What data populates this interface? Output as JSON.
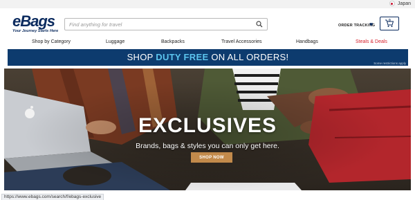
{
  "locale": {
    "label": "Japan"
  },
  "header": {
    "logo_text": "eBags",
    "logo_tagline": "Your Journey Starts Here",
    "search_placeholder": "Find anything for travel",
    "order_tracking": "ORDER TRACKING",
    "cart_count": "0"
  },
  "nav": {
    "items": [
      {
        "label": "Shop by Category"
      },
      {
        "label": "Luggage"
      },
      {
        "label": "Backpacks"
      },
      {
        "label": "Travel Accessories"
      },
      {
        "label": "Handbags"
      },
      {
        "label": "Steals & Deals"
      }
    ]
  },
  "banner": {
    "text_pre": "SHOP ",
    "text_highlight": "DUTY FREE",
    "text_post": " ON ALL ORDERS!",
    "note": "Some restrictions apply"
  },
  "hero": {
    "title": "EXCLUSIVES",
    "subtitle": "Brands, bags & styles you can only get here.",
    "cta": "SHOP NOW"
  },
  "status": {
    "url": "https://www.ebags.com/search/f/ebags-exclusive"
  },
  "colors": {
    "brand_navy": "#0a2a5e",
    "banner_bg": "#0d3b6e",
    "highlight": "#5bc4ee",
    "deal_red": "#d6202c",
    "cta_bg": "#c28a4b"
  }
}
